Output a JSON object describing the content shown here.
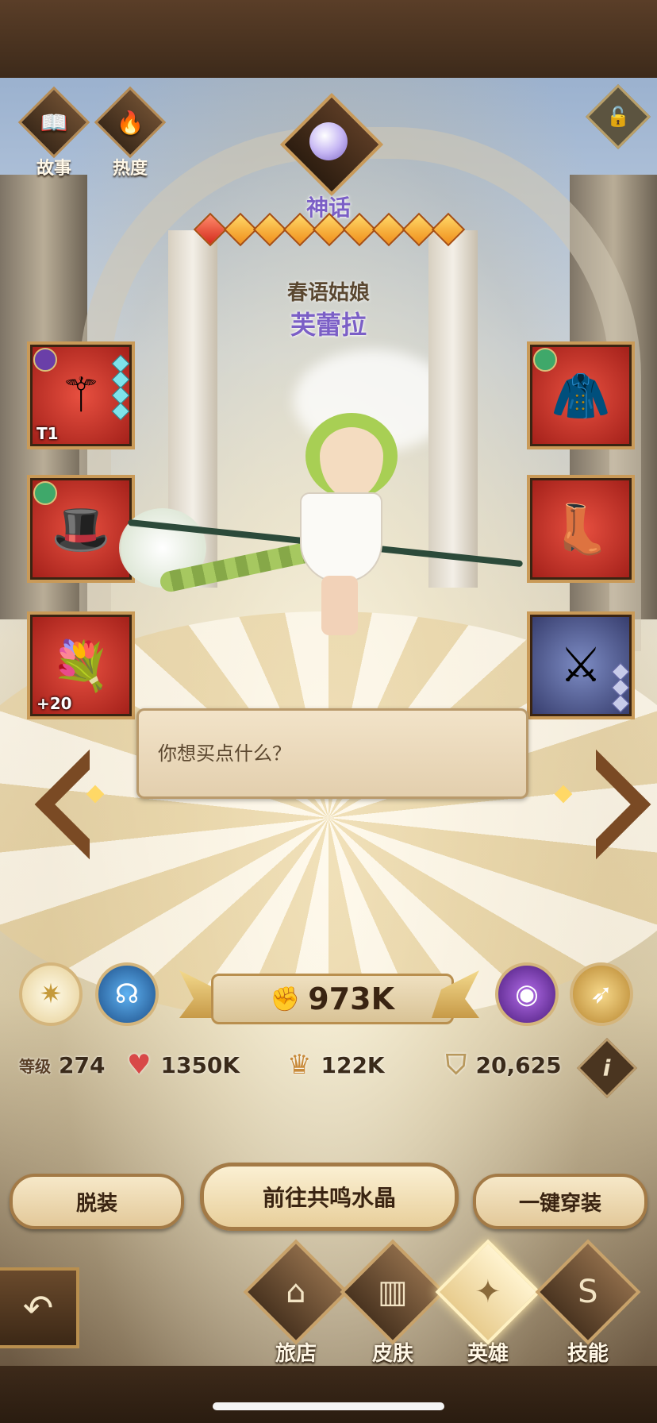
{
  "header": {
    "story_label": "故事",
    "heat_label": "热度",
    "rarity": "神话",
    "hero_title": "春语姑娘",
    "hero_name": "芙蕾拉",
    "star_count": 9
  },
  "equipment": {
    "left": [
      {
        "name": "weapon",
        "tag": "T1",
        "stars": 4
      },
      {
        "name": "hat",
        "tag": "",
        "stars": 0
      },
      {
        "name": "relic",
        "tag": "+20",
        "stars": 0
      }
    ],
    "right": [
      {
        "name": "armor",
        "tag": "",
        "stars": 0
      },
      {
        "name": "boots",
        "tag": "",
        "stars": 0
      },
      {
        "name": "signature-item",
        "tag": "",
        "stars": 3
      }
    ]
  },
  "dialog": {
    "text": "你想买点什么？"
  },
  "power": {
    "value": "973K"
  },
  "stats": {
    "level_label": "等级",
    "level": "274",
    "hp": "1350K",
    "attack": "122K",
    "defense": "20,625"
  },
  "actions": {
    "unequip": "脱装",
    "resonance": "前往共鸣水晶",
    "equip_all": "一键穿装"
  },
  "nav": {
    "tavern": "旅店",
    "skins": "皮肤",
    "heroes": "英雄",
    "skills": "技能"
  },
  "colors": {
    "rarity_purple": "#7b5fc6",
    "slot_red": "#c8352a",
    "gold_border": "#c99a58"
  }
}
